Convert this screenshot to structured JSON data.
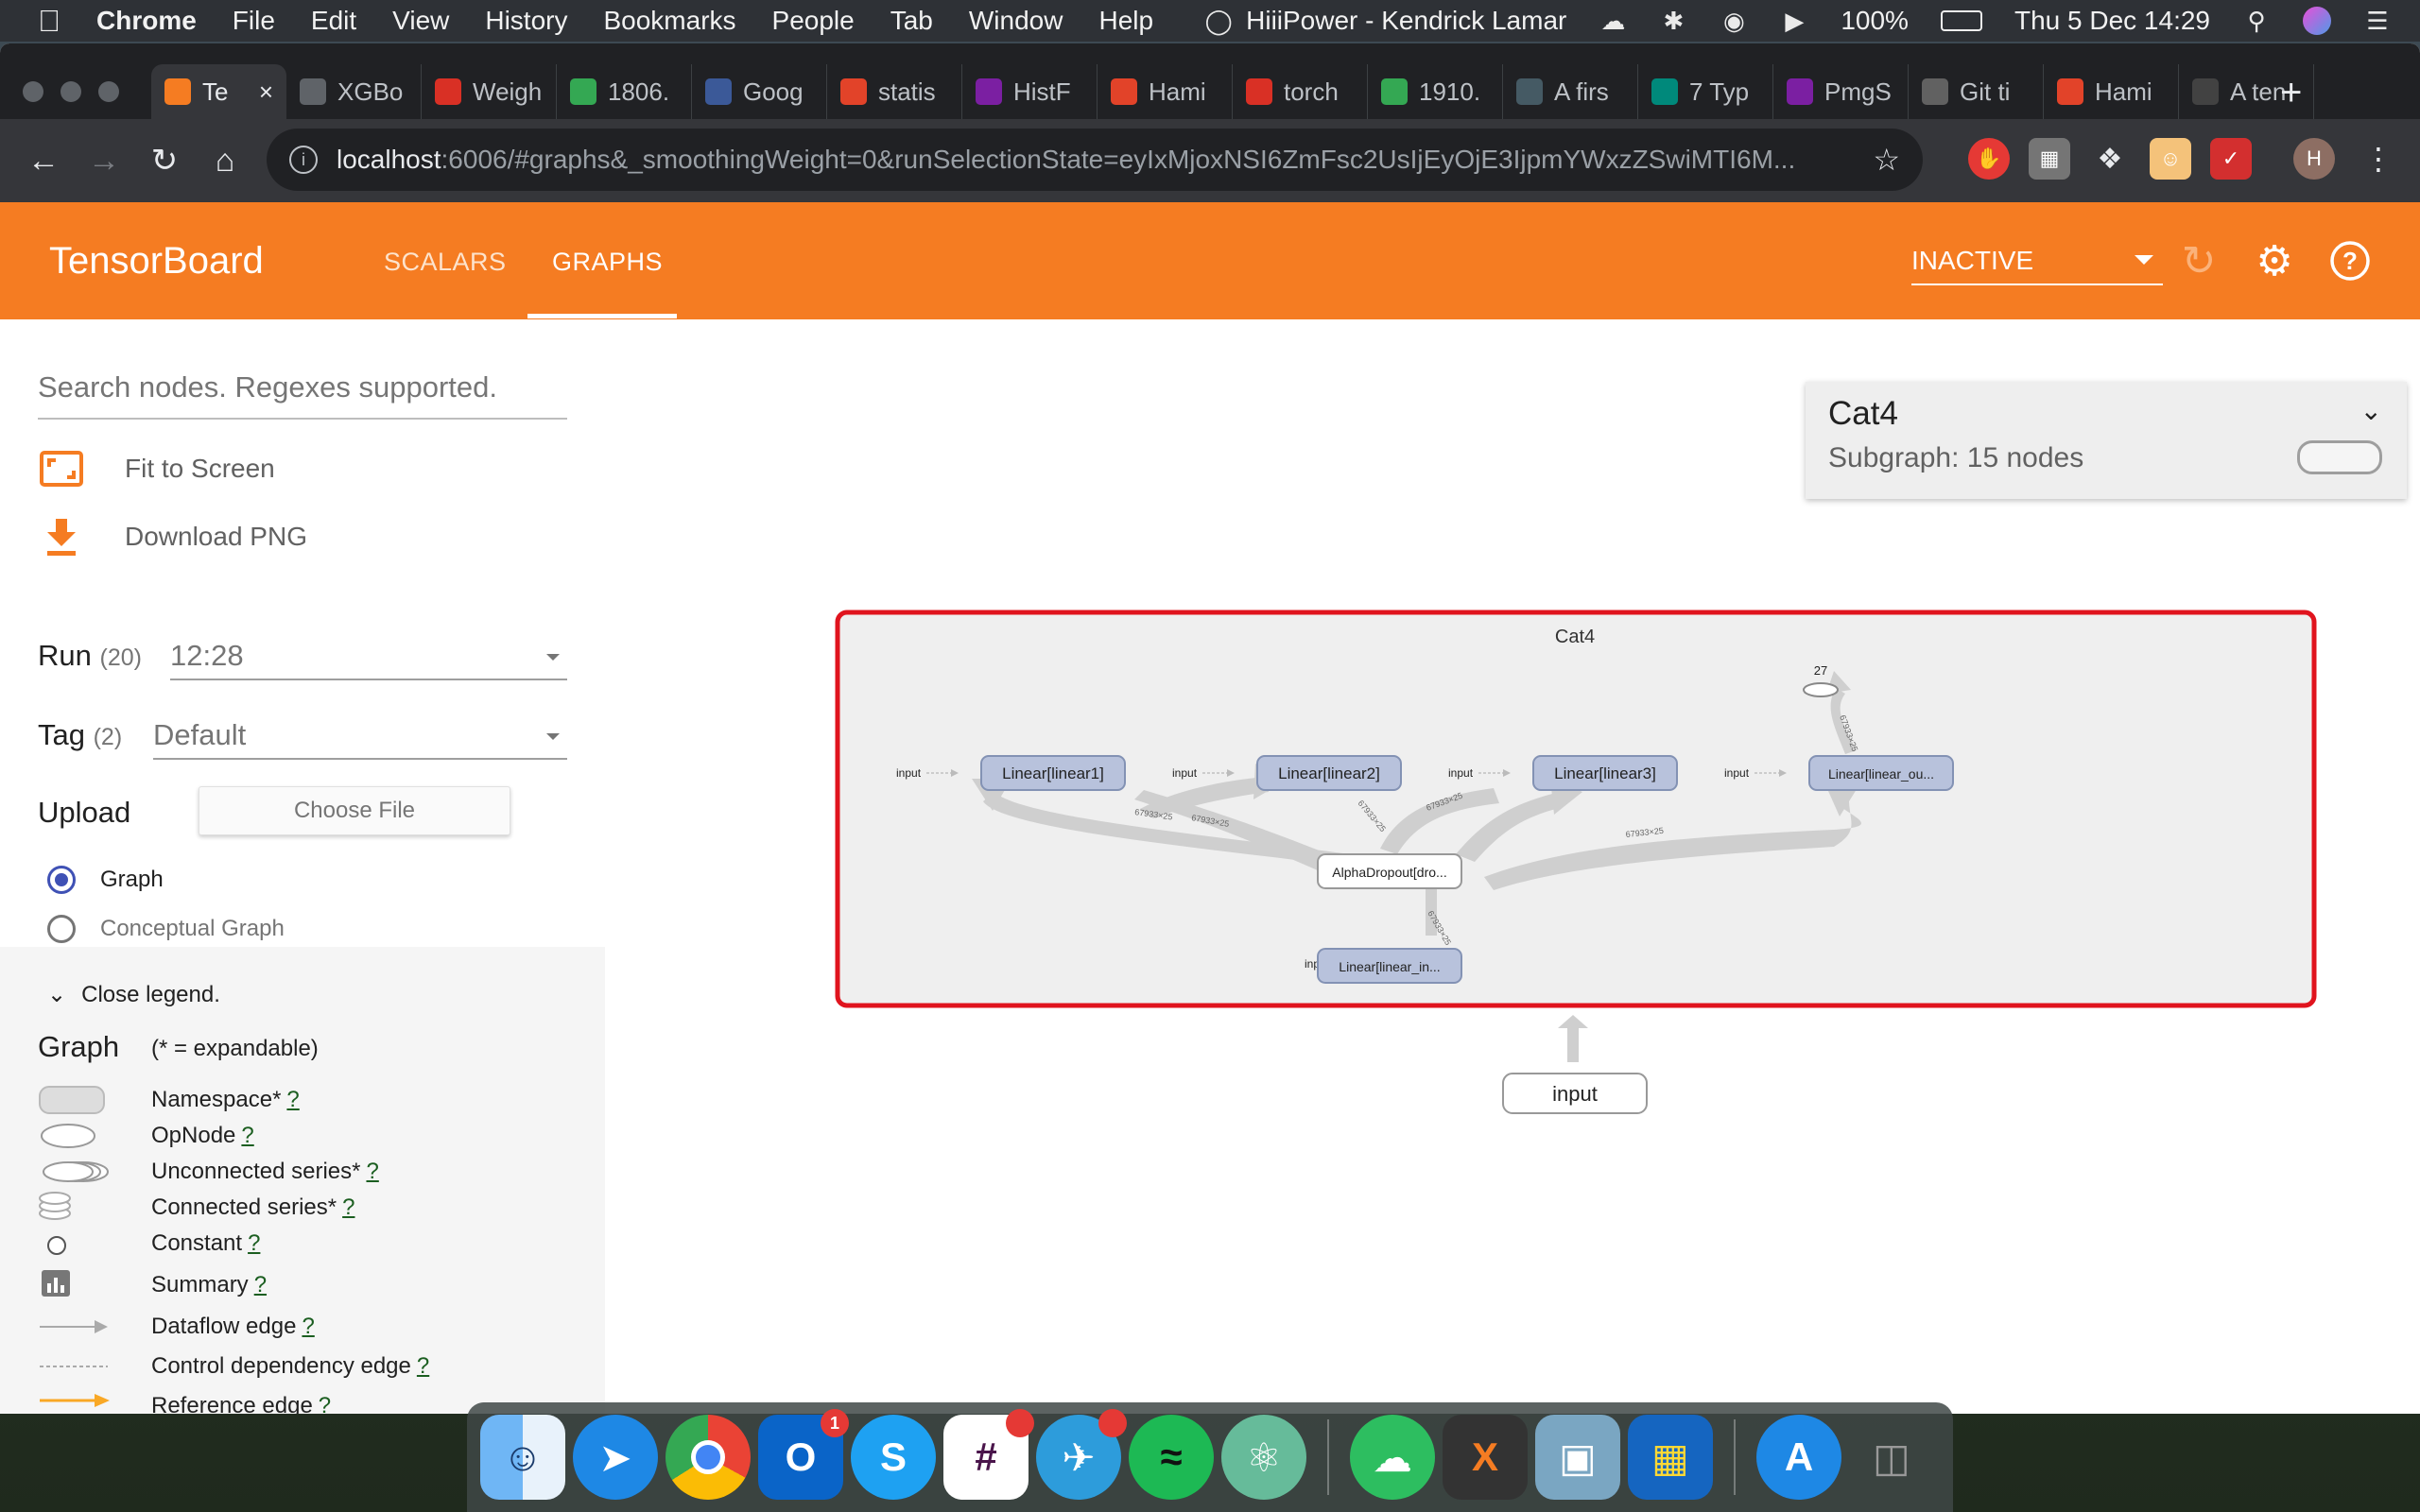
{
  "menubar": {
    "app": "Chrome",
    "menus": [
      "File",
      "Edit",
      "View",
      "History",
      "Bookmarks",
      "People",
      "Tab",
      "Window",
      "Help"
    ],
    "now_playing": "HiiiPower - Kendrick Lamar",
    "battery": "100%",
    "clock": "Thu 5 Dec  14:29"
  },
  "tabs": [
    {
      "title": "Te",
      "color": "#f57c22",
      "active": true
    },
    {
      "title": "XGBo",
      "color": "#5f6368"
    },
    {
      "title": "Weigh",
      "color": "#d93025"
    },
    {
      "title": "1806.",
      "color": "#34a853"
    },
    {
      "title": "Goog",
      "color": "#3b5998"
    },
    {
      "title": "statis",
      "color": "#e24329"
    },
    {
      "title": "HistF",
      "color": "#7b1fa2"
    },
    {
      "title": "Hami",
      "color": "#e24329"
    },
    {
      "title": "torch",
      "color": "#d93025"
    },
    {
      "title": "1910.",
      "color": "#34a853"
    },
    {
      "title": "A firs",
      "color": "#455a64"
    },
    {
      "title": "7 Typ",
      "color": "#00897b"
    },
    {
      "title": "PmgS",
      "color": "#7b1fa2"
    },
    {
      "title": "Git ti",
      "color": "#616161"
    },
    {
      "title": "Hami",
      "color": "#e24329"
    },
    {
      "title": "A ten",
      "color": "#424242"
    }
  ],
  "omnibox": {
    "host": "localhost",
    "path": ":6006/#graphs&_smoothingWeight=0&runSelectionState=eyIxMjoxNSI6ZmFsc2UsIjEyOjE3IjpmYWxzZSwiMTI6M..."
  },
  "tensorboard": {
    "brand": "TensorBoard",
    "tabs": [
      "SCALARS",
      "GRAPHS"
    ],
    "active_tab": "GRAPHS",
    "status": "INACTIVE"
  },
  "sidebar": {
    "search_placeholder": "Search nodes. Regexes supported.",
    "fit_to_screen": "Fit to Screen",
    "download_png": "Download PNG",
    "run_label": "Run",
    "run_count": "(20)",
    "run_value": "12:28",
    "tag_label": "Tag",
    "tag_count": "(2)",
    "tag_value": "Default",
    "upload_label": "Upload",
    "choose_file": "Choose File",
    "radio_graph": "Graph",
    "radio_conceptual": "Conceptual Graph"
  },
  "legend": {
    "toggle": "Close legend.",
    "title": "Graph",
    "note": "(* = expandable)",
    "q": "?",
    "items": [
      "Namespace*",
      "OpNode",
      "Unconnected series*",
      "Connected series*",
      "Constant",
      "Summary",
      "Dataflow edge",
      "Control dependency edge",
      "Reference edge"
    ]
  },
  "info_card": {
    "title": "Cat4",
    "subtitle": "Subgraph: 15 nodes"
  },
  "graph": {
    "namespace_title": "Cat4",
    "output_label": "27",
    "input_label": "input",
    "nodes": {
      "linear1": "Linear[linear1]",
      "linear2": "Linear[linear2]",
      "linear3": "Linear[linear3]",
      "linear_out": "Linear[linear_ou...",
      "dropout": "AlphaDropout[dro...",
      "linear_in": "Linear[linear_in..."
    },
    "edge_label": "67933×25",
    "outer_input": "input"
  },
  "dock": {
    "apps": [
      "finder-icon",
      "safari-icon",
      "chrome-icon",
      "outlook-icon",
      "skype-icon",
      "slack-icon",
      "mail-icon",
      "spotify-icon",
      "atom-icon",
      "evernote-icon",
      "x11-icon",
      "preview-icon",
      "layers-icon",
      "appstore-icon",
      "trash-icon"
    ],
    "outlook_badge": "1"
  }
}
